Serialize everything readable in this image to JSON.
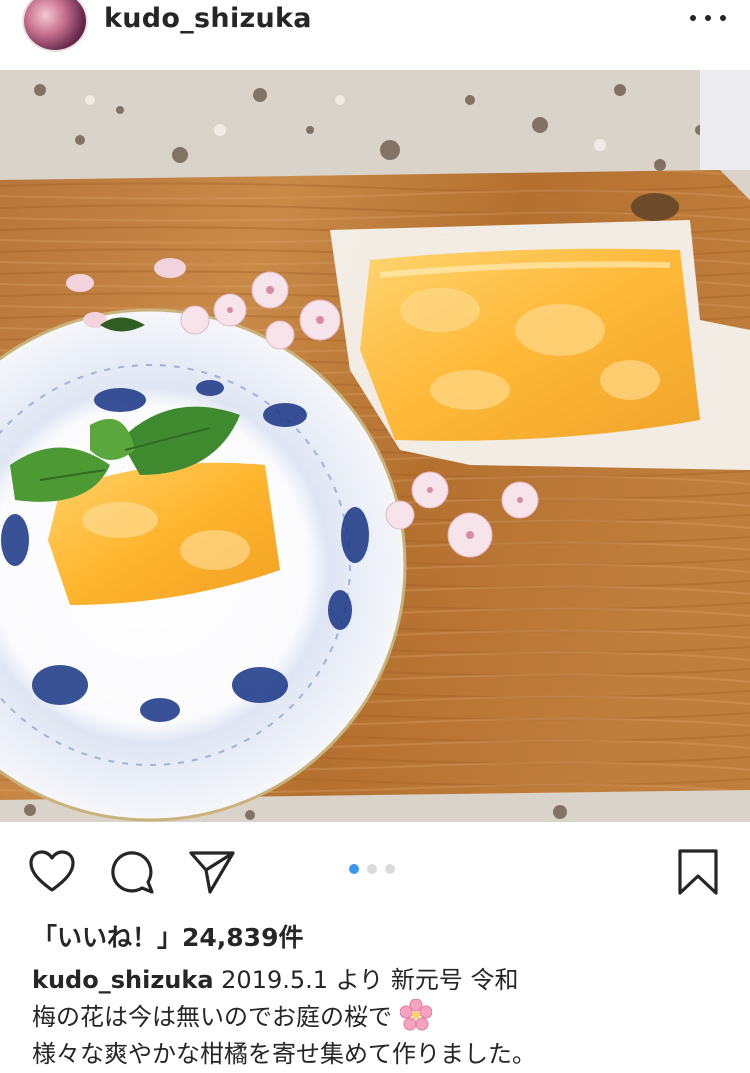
{
  "post": {
    "username": "kudo_shizuka"
  },
  "header": {
    "avatar_icon": "profile-avatar",
    "more_icon": "ellipsis-icon"
  },
  "image": {
    "description_icon": "photo"
  },
  "actions": {
    "like_icon": "heart-icon",
    "comment_icon": "comment-icon",
    "share_icon": "paper-plane-icon",
    "save_icon": "bookmark-icon",
    "carousel_pages": 3,
    "carousel_active": 1
  },
  "likes": {
    "text": "「いいね！」24,839件"
  },
  "caption": {
    "username": "kudo_shizuka",
    "line1_rest": " 2019.5.1 より  新元号 令和",
    "line2": "梅の花は今は無いのでお庭の桜で",
    "line3": "様々な爽やかな柑橘を寄せ集めて作りました。",
    "emoji": "cherry-blossom"
  },
  "colors": {
    "accent": "#3897f0",
    "text": "#262626"
  }
}
